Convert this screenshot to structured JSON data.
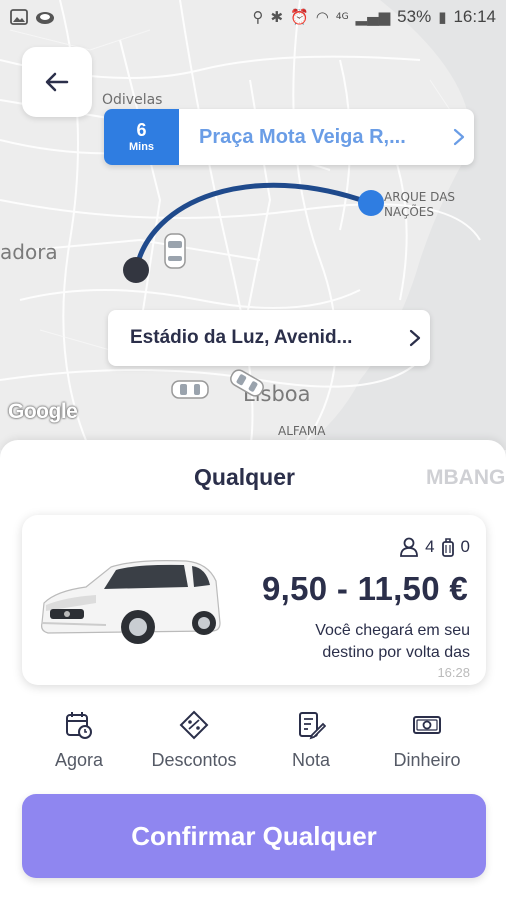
{
  "status_bar": {
    "battery": "53%",
    "time": "16:14",
    "network": "4G"
  },
  "map": {
    "labels": {
      "odivelas": "Odivelas",
      "adora": "adora",
      "parque_line1": "ARQUE DAS",
      "parque_line2": "NAÇÕES",
      "lisboa": "Lisboa",
      "alfama": "ALFAMA"
    },
    "attribution": "Google",
    "route_color": "#1f4a8c"
  },
  "destination": {
    "eta_value": "6",
    "eta_unit": "Mins",
    "address": "Praça Mota Veiga R,..."
  },
  "origin": {
    "address": "Estádio da Luz, Avenid..."
  },
  "tabs": {
    "active": "Qualquer",
    "next": "MBANG"
  },
  "vehicle": {
    "passengers": "4",
    "luggage": "0",
    "price": "9,50  - 11,50 €",
    "arrival_text": "Você chegará em seu destino por volta das",
    "arrival_time_partial": "16:28"
  },
  "options": [
    {
      "label": "Agora",
      "icon": "calendar-clock-icon"
    },
    {
      "label": "Descontos",
      "icon": "discount-tag-icon"
    },
    {
      "label": "Nota",
      "icon": "note-edit-icon"
    },
    {
      "label": "Dinheiro",
      "icon": "cash-icon"
    }
  ],
  "confirm_label": "Confirmar Qualquer",
  "colors": {
    "accent_blue": "#2f7de1",
    "confirm": "#8f86f0",
    "text_dark": "#2b2f4a"
  }
}
